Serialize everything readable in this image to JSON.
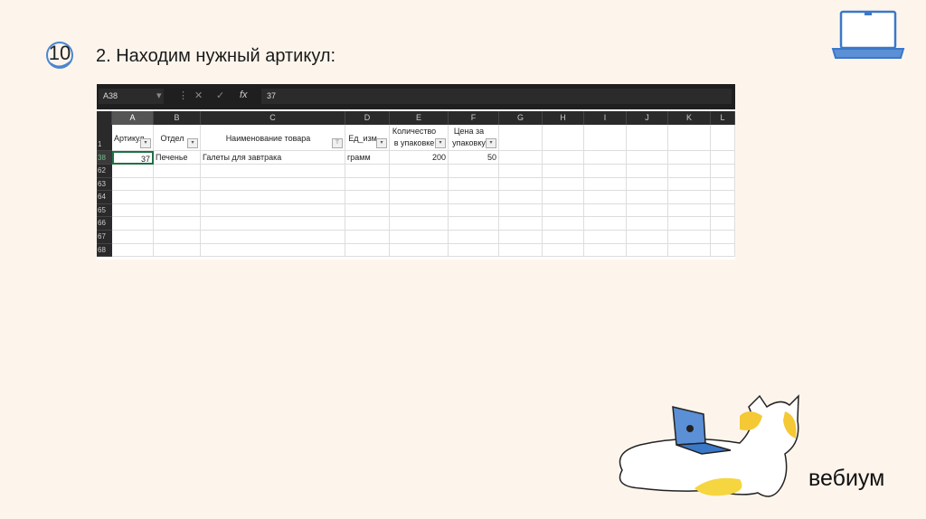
{
  "slide": {
    "number": "10",
    "title": "2. Находим нужный артикул:",
    "brand": "вебиум"
  },
  "excel": {
    "name_box": "A38",
    "formula_value": "37",
    "fx": "fx",
    "columns": [
      "A",
      "B",
      "C",
      "D",
      "E",
      "F",
      "G",
      "H",
      "I",
      "J",
      "K",
      "L"
    ],
    "headers": [
      "Артикул",
      "Отдел",
      "Наименование товара",
      "Ед_изм",
      "Количество в упаковке",
      "Цена за упаковку"
    ],
    "row_numbers": [
      "1",
      "38",
      "62",
      "63",
      "64",
      "65",
      "66",
      "67",
      "68"
    ],
    "row38": [
      "37",
      "Печенье",
      "Галеты для завтрака",
      "грамм",
      "200",
      "50"
    ]
  },
  "colors": {
    "accent": "#3a78c9",
    "excel_dark": "#1f1f1f"
  }
}
